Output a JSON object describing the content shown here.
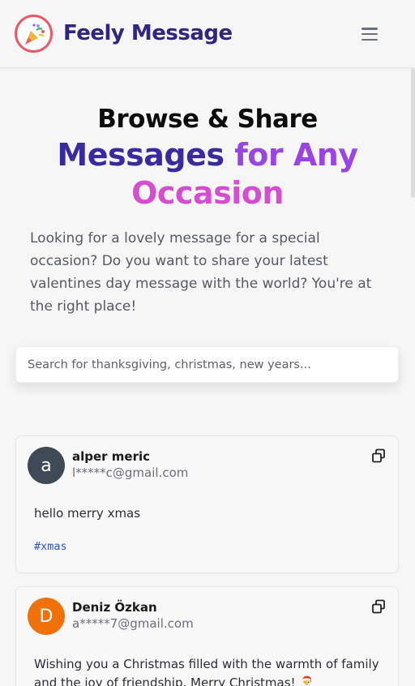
{
  "header": {
    "brand": "Feely Message",
    "logo_icon": "party-popper-icon",
    "menu_icon": "hamburger-menu-icon"
  },
  "hero": {
    "line1": "Browse & Share",
    "line2_a": "Messages ",
    "line2_b": "for Any",
    "line3": "Occasion",
    "intro": "Looking for a lovely message for a special occasion? Do you want to share your latest valentines day message with the world? You're at the right place!"
  },
  "search": {
    "placeholder": "Search for thanksgiving, christmas, new years...",
    "value": ""
  },
  "messages": [
    {
      "avatar_letter": "a",
      "avatar_color": "#3f4a56",
      "name": "alper meric",
      "email": "l*****c@gmail.com",
      "text": "hello merry xmas",
      "tag": "#xmas",
      "copy_icon": "copy-icon"
    },
    {
      "avatar_letter": "D",
      "avatar_color": "#f0700a",
      "name": "Deniz Özkan",
      "email": "a*****7@gmail.com",
      "text": "Wishing you a Christmas filled with the warmth of family and the joy of friendship. Merry Christmas! 🎅",
      "copy_icon": "copy-icon"
    }
  ],
  "colors": {
    "brand": "#2f2682",
    "accent_purple": "#9a45e2",
    "accent_pink": "#d64ed0",
    "tag_link": "#2a55c7"
  }
}
